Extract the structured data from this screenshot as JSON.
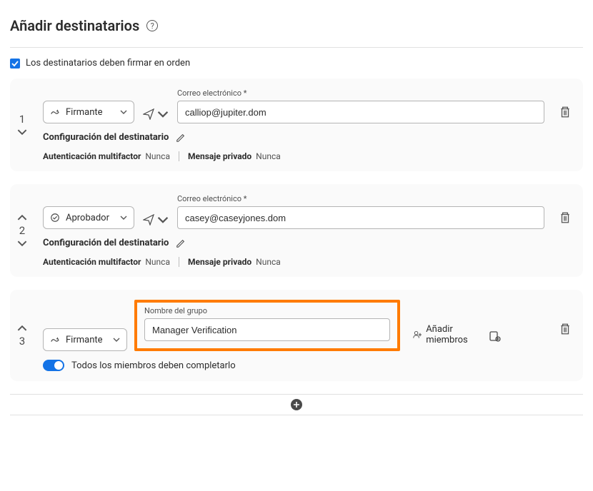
{
  "header": {
    "title": "Añadir destinatarios"
  },
  "order": {
    "label": "Los destinatarios deben firmar en orden",
    "checked": true
  },
  "emailLabel": "Correo electrónico *",
  "configLabel": "Configuración del destinatario",
  "mfaLabel": "Autenticación multifactor",
  "privMsgLabel": "Mensaje privado",
  "neverVal": "Nunca",
  "recipients": [
    {
      "num": "1",
      "role": "Firmante",
      "email": "calliop@jupiter.dom"
    },
    {
      "num": "2",
      "role": "Aprobador",
      "email": "casey@caseyjones.dom"
    }
  ],
  "group": {
    "num": "3",
    "role": "Firmante",
    "nameLabel": "Nombre del grupo",
    "nameValue": "Manager Verification",
    "addMembers": "Añadir miembros",
    "toggleLabel": "Todos los miembros deben completarlo"
  }
}
